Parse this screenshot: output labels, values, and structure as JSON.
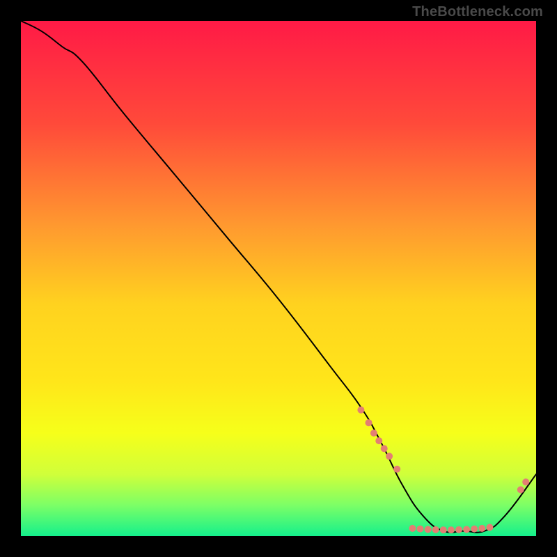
{
  "watermark": "TheBottleneck.com",
  "chart_data": {
    "type": "line",
    "title": "",
    "xlabel": "",
    "ylabel": "",
    "xlim": [
      0,
      100
    ],
    "ylim": [
      0,
      100
    ],
    "grid": false,
    "legend": false,
    "background": {
      "kind": "vertical-gradient",
      "stops": [
        {
          "pos": 0.0,
          "color": "#ff1a46"
        },
        {
          "pos": 0.2,
          "color": "#ff4a3a"
        },
        {
          "pos": 0.4,
          "color": "#ff9a2f"
        },
        {
          "pos": 0.55,
          "color": "#ffd21f"
        },
        {
          "pos": 0.7,
          "color": "#ffe61a"
        },
        {
          "pos": 0.8,
          "color": "#f6ff1a"
        },
        {
          "pos": 0.88,
          "color": "#d0ff3a"
        },
        {
          "pos": 0.94,
          "color": "#7cff66"
        },
        {
          "pos": 1.0,
          "color": "#14f08c"
        }
      ]
    },
    "series": [
      {
        "name": "bottleneck-curve",
        "color": "#000000",
        "x": [
          0,
          4,
          8,
          12,
          20,
          30,
          40,
          50,
          60,
          66,
          70,
          74,
          78,
          82,
          86,
          90,
          94,
          100
        ],
        "y": [
          100,
          98,
          95,
          92,
          82,
          70,
          58,
          46,
          33,
          25,
          18,
          10,
          4,
          1,
          1,
          1,
          4,
          12
        ]
      }
    ],
    "markers": {
      "name": "sample-points",
      "color": "#e37f73",
      "radius_px": 5,
      "points": [
        {
          "x": 66.0,
          "y": 24.5
        },
        {
          "x": 67.5,
          "y": 22.0
        },
        {
          "x": 68.5,
          "y": 20.0
        },
        {
          "x": 69.5,
          "y": 18.5
        },
        {
          "x": 70.5,
          "y": 17.0
        },
        {
          "x": 71.5,
          "y": 15.5
        },
        {
          "x": 73.0,
          "y": 13.0
        },
        {
          "x": 76.0,
          "y": 1.5
        },
        {
          "x": 77.5,
          "y": 1.4
        },
        {
          "x": 79.0,
          "y": 1.3
        },
        {
          "x": 80.5,
          "y": 1.25
        },
        {
          "x": 82.0,
          "y": 1.2
        },
        {
          "x": 83.5,
          "y": 1.2
        },
        {
          "x": 85.0,
          "y": 1.25
        },
        {
          "x": 86.5,
          "y": 1.3
        },
        {
          "x": 88.0,
          "y": 1.4
        },
        {
          "x": 89.5,
          "y": 1.5
        },
        {
          "x": 91.0,
          "y": 1.7
        },
        {
          "x": 97.0,
          "y": 9.0
        },
        {
          "x": 98.0,
          "y": 10.5
        }
      ]
    }
  }
}
